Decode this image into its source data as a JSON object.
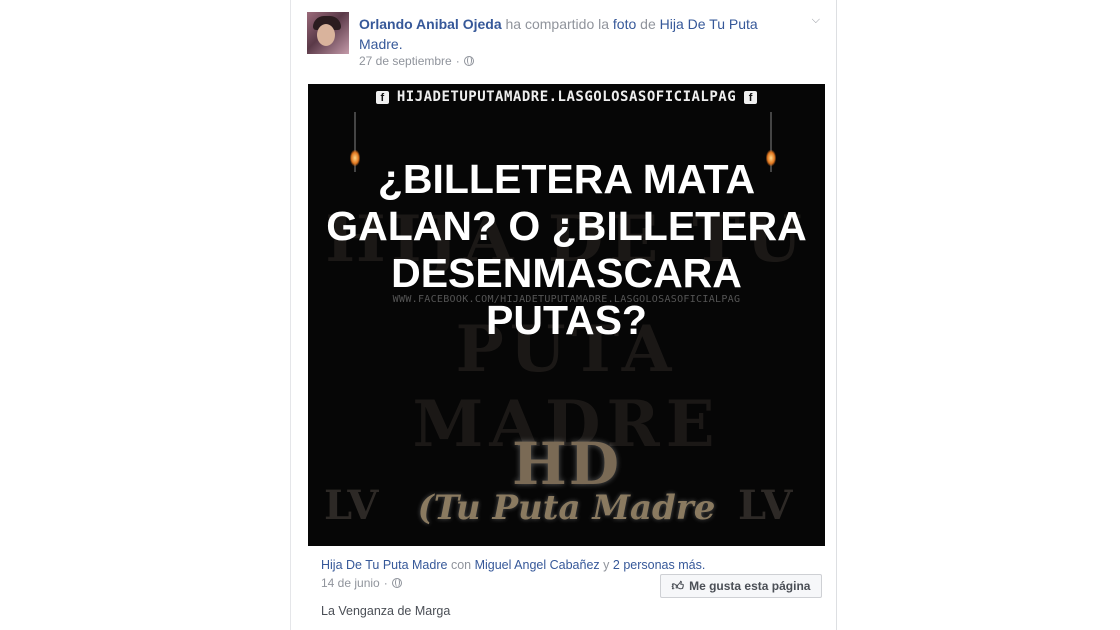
{
  "post": {
    "author": "Orlando Anibal Ojeda",
    "action_1": "ha compartido la",
    "action_link": "foto",
    "action_2": "de",
    "source_page": "Hija De Tu Puta Madre",
    "date": "27 de septiembre",
    "separator": "·",
    "menu_icon": "chevron-down-icon",
    "privacy_icon": "globe-icon"
  },
  "image": {
    "banner_icon": "f",
    "banner_text": "HIJADETUPUTAMADRE.LASGOLOSASOFICIALPAG",
    "watermark_url": "WWW.FACEBOOK.COM/HIJADETUPUTAMADRE.LASGOLOSASOFICIALPAG",
    "watermark_1": "HIJA DE TU",
    "watermark_2": "PUTA MADRE",
    "headline": "¿BILLETERA MATA GALAN? O ¿BILLETERA DESENMASCARA PUTAS?",
    "logo_hd": "HD",
    "logo_script": "(Tu Puta Madre",
    "logo_lv": "LV"
  },
  "shared": {
    "page": "Hija De Tu Puta Madre",
    "with_text": "con",
    "tagged": "Miguel Angel Cabañez",
    "and_text": "y",
    "others": "2 personas más.",
    "date": "14 de junio",
    "separator": "·",
    "like_page_label": "Me gusta esta página",
    "caption": "La Venganza de Marga"
  }
}
